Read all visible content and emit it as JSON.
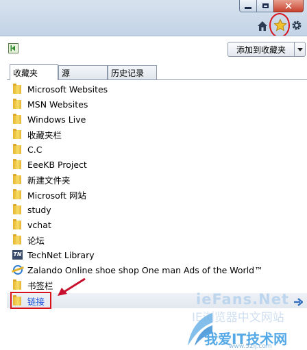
{
  "toolbar": {
    "add_to_favorites": "添加到收藏夹"
  },
  "tabs": [
    {
      "label": "收藏夹",
      "active": true
    },
    {
      "label": "源",
      "active": false
    },
    {
      "label": "历史记录",
      "active": false
    }
  ],
  "favorites": [
    {
      "label": "Microsoft Websites",
      "icon": "folder-icon"
    },
    {
      "label": "MSN Websites",
      "icon": "folder-icon"
    },
    {
      "label": "Windows Live",
      "icon": "folder-icon"
    },
    {
      "label": "收藏夹栏",
      "icon": "folder-icon"
    },
    {
      "label": "C.C",
      "icon": "folder-icon"
    },
    {
      "label": "EeeKB Project",
      "icon": "folder-icon"
    },
    {
      "label": "新建文件夹",
      "icon": "folder-icon"
    },
    {
      "label": "Microsoft 网站",
      "icon": "folder-icon"
    },
    {
      "label": "study",
      "icon": "folder-icon"
    },
    {
      "label": "vchat",
      "icon": "folder-icon"
    },
    {
      "label": "论坛",
      "icon": "folder-icon"
    },
    {
      "label": "TechNet Library",
      "icon": "technet-icon"
    },
    {
      "label": "Zalando Online shoe shop One man Ads of the World™",
      "icon": "ie-page-icon"
    },
    {
      "label": "书签栏",
      "icon": "folder-icon"
    },
    {
      "label": "链接",
      "icon": "folder-icon",
      "selected": true
    }
  ],
  "watermark": {
    "brand": "ieFans.Net",
    "tagline": "IE浏览器中文网站",
    "site": "我爱IT技术网",
    "url": "www.52ij.com"
  },
  "colors": {
    "highlight_red": "#d8121a",
    "link_blue": "#1a4fd8",
    "title_bar": "#c3d3e6"
  }
}
